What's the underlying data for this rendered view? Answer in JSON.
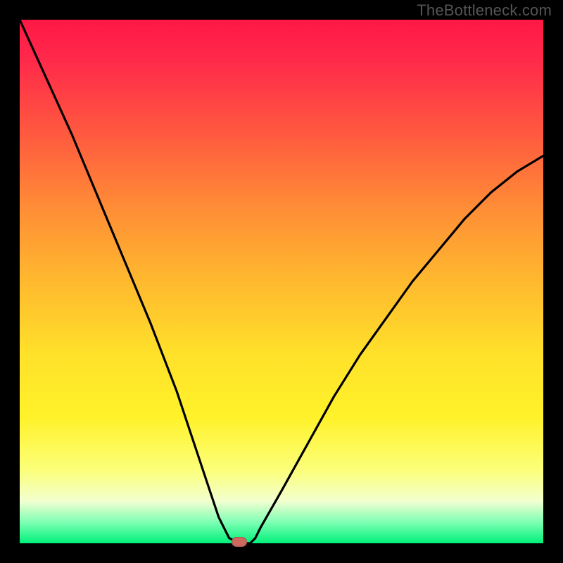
{
  "watermark": {
    "text": "TheBottleneck.com"
  },
  "colors": {
    "frame": "#000000",
    "gradient_top": "#ff1846",
    "gradient_mid": "#ffe12a",
    "gradient_bottom": "#00f07a",
    "curve": "#000000",
    "marker": "#cc6a60"
  },
  "chart_data": {
    "type": "line",
    "title": "",
    "xlabel": "",
    "ylabel": "",
    "xlim": [
      0,
      100
    ],
    "ylim": [
      0,
      100
    ],
    "series": [
      {
        "name": "bottleneck-curve",
        "x": [
          0,
          5,
          10,
          15,
          20,
          25,
          30,
          33,
          36,
          38,
          40,
          42,
          44,
          45,
          46,
          50,
          55,
          60,
          65,
          70,
          75,
          80,
          85,
          90,
          95,
          100
        ],
        "values": [
          100,
          89,
          78,
          66,
          54,
          42,
          29,
          20,
          11,
          5,
          1,
          0,
          0,
          1,
          3,
          10,
          19,
          28,
          36,
          43,
          50,
          56,
          62,
          67,
          71,
          74
        ]
      }
    ],
    "annotations": [
      {
        "name": "optimal-marker",
        "x": 42,
        "y": 0
      }
    ]
  }
}
